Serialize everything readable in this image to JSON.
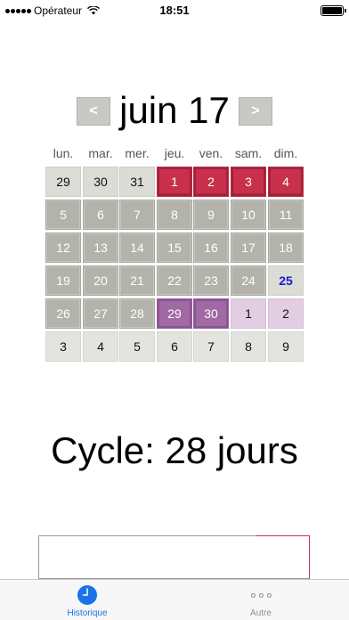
{
  "status_bar": {
    "carrier": "Opérateur",
    "time": "18:51",
    "battery_level": 1.0
  },
  "month_nav": {
    "prev_label": "<",
    "title": "juin 17",
    "next_label": ">"
  },
  "weekdays": [
    "lun.",
    "mar.",
    "mer.",
    "jeu.",
    "ven.",
    "sam.",
    "dim."
  ],
  "calendar": {
    "today": "25",
    "weeks": [
      [
        {
          "day": "29",
          "style": "gray-light"
        },
        {
          "day": "30",
          "style": "gray-light"
        },
        {
          "day": "31",
          "style": "gray-light"
        },
        {
          "day": "1",
          "style": "red"
        },
        {
          "day": "2",
          "style": "red"
        },
        {
          "day": "3",
          "style": "red"
        },
        {
          "day": "4",
          "style": "red"
        }
      ],
      [
        {
          "day": "5",
          "style": "gray"
        },
        {
          "day": "6",
          "style": "gray"
        },
        {
          "day": "7",
          "style": "gray"
        },
        {
          "day": "8",
          "style": "gray"
        },
        {
          "day": "9",
          "style": "gray"
        },
        {
          "day": "10",
          "style": "gray"
        },
        {
          "day": "11",
          "style": "gray"
        }
      ],
      [
        {
          "day": "12",
          "style": "gray"
        },
        {
          "day": "13",
          "style": "gray"
        },
        {
          "day": "14",
          "style": "gray"
        },
        {
          "day": "15",
          "style": "gray"
        },
        {
          "day": "16",
          "style": "gray"
        },
        {
          "day": "17",
          "style": "gray"
        },
        {
          "day": "18",
          "style": "gray"
        }
      ],
      [
        {
          "day": "19",
          "style": "gray"
        },
        {
          "day": "20",
          "style": "gray"
        },
        {
          "day": "21",
          "style": "gray"
        },
        {
          "day": "22",
          "style": "gray"
        },
        {
          "day": "23",
          "style": "gray"
        },
        {
          "day": "24",
          "style": "gray"
        },
        {
          "day": "25",
          "style": "gray-light today"
        }
      ],
      [
        {
          "day": "26",
          "style": "gray"
        },
        {
          "day": "27",
          "style": "gray"
        },
        {
          "day": "28",
          "style": "gray"
        },
        {
          "day": "29",
          "style": "purple"
        },
        {
          "day": "30",
          "style": "purple"
        },
        {
          "day": "1",
          "style": "purple-light"
        },
        {
          "day": "2",
          "style": "purple-light"
        }
      ],
      [
        {
          "day": "3",
          "style": "plain"
        },
        {
          "day": "4",
          "style": "plain"
        },
        {
          "day": "5",
          "style": "plain"
        },
        {
          "day": "6",
          "style": "plain"
        },
        {
          "day": "7",
          "style": "plain"
        },
        {
          "day": "8",
          "style": "plain"
        },
        {
          "day": "9",
          "style": "plain"
        }
      ]
    ]
  },
  "cycle_text": "Cycle: 28 jours",
  "tab_bar": {
    "tabs": [
      {
        "label": "Historique",
        "icon": "clock-icon",
        "active": true
      },
      {
        "label": "Autre",
        "icon": "more-dots-icon",
        "active": false
      }
    ]
  },
  "colors": {
    "period": "#c8304b",
    "fertile": "#a16aa5",
    "fertile_light": "#e3cde3",
    "neutral": "#b3b3ac",
    "today_text": "#1a1ad6",
    "tab_active": "#1a73e8"
  }
}
